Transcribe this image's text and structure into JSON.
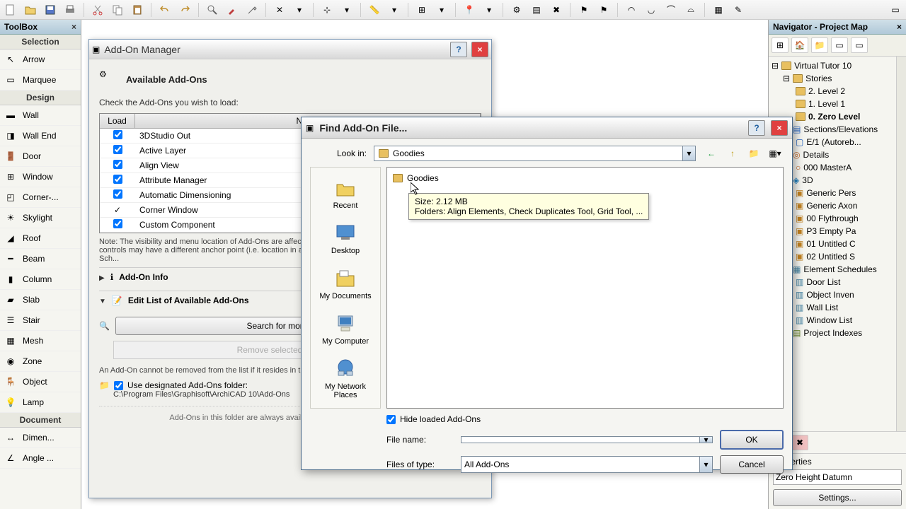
{
  "toolbox": {
    "title": "ToolBox",
    "selectionHead": "Selection",
    "designHead": "Design",
    "documentHead": "Document",
    "items": {
      "arrow": "Arrow",
      "marquee": "Marquee",
      "wall": "Wall",
      "wallEnd": "Wall End",
      "door": "Door",
      "window": "Window",
      "corner": "Corner-...",
      "skylight": "Skylight",
      "roof": "Roof",
      "beam": "Beam",
      "column": "Column",
      "slab": "Slab",
      "stair": "Stair",
      "mesh": "Mesh",
      "zone": "Zone",
      "object": "Object",
      "lamp": "Lamp",
      "dimen": "Dimen...",
      "angle": "Angle ..."
    }
  },
  "navigator": {
    "title": "Navigator - Project Map",
    "root": "Virtual Tutor 10",
    "stories": "Stories",
    "level2": "2. Level 2",
    "level1": "1. Level 1",
    "zero": "0. Zero Level",
    "sections": "Sections/Elevations",
    "e1": "E/1 (Autoreb...",
    "details": "Details",
    "masterA": "000 MasterA",
    "threeD": "3D",
    "genericPers": "Generic Pers",
    "genericAxon": "Generic Axon",
    "flythrough": "00 Flythrough",
    "emptyPa": "P3 Empty Pa",
    "untitledC1": "01 Untitled C",
    "untitledS": "02 Untitled S",
    "elementSched": "Element Schedules",
    "doorList": "Door List",
    "objectInven": "Object Inven",
    "wallList": "Wall List",
    "windowList": "Window List",
    "projectIndexes": "Project Indexes",
    "propsLabel": "Properties",
    "datum": "Zero Height Datumn",
    "settings": "Settings..."
  },
  "addonManager": {
    "title": "Add-On Manager",
    "availableHead": "Available Add-Ons",
    "checkNote": "Check the Add-Ons you wish to load:",
    "colLoad": "Load",
    "colName": "Name",
    "rows": [
      "3DStudio Out",
      "Active Layer",
      "Align View",
      "Attribute Manager",
      "Automatic Dimensioning",
      "Corner Window",
      "Custom Component"
    ],
    "noteTruncated": "Note: The visibility and menu location of Add-Ons are affected by Work Environment settings. The Add-On controls may have a different anchor point (i.e. location in a menu) of Work Environment > Command Layout Sch...",
    "infoHead": "Add-On Info",
    "editHead": "Edit List of Available Add-Ons",
    "searchBtn": "Search for more Add-Ons...",
    "removeBtn": "Remove selected Add-On",
    "removeNote": "An Add-On cannot be removed from the list if it resides in the Add-Ons folder.",
    "designatedCheck": "Use designated Add-Ons folder:",
    "path": "C:\\Program Files\\Graphisoft\\ArchiCAD 10\\Add-Ons",
    "finalNote": "Add-Ons in this folder are always available in the Add-On Manager list"
  },
  "findDialog": {
    "title": "Find Add-On File...",
    "lookInLabel": "Look in:",
    "lookInValue": "Goodies",
    "places": {
      "recent": "Recent",
      "desktop": "Desktop",
      "mydocs": "My Documents",
      "mycomp": "My Computer",
      "network": "My Network Places"
    },
    "fileItem": "Goodies",
    "tooltipSize": "Size: 2.12 MB",
    "tooltipFolders": "Folders: Align Elements, Check Duplicates Tool, Grid Tool, ...",
    "hideLoaded": "Hide loaded Add-Ons",
    "fileNameLabel": "File name:",
    "fileNameValue": "",
    "typeLabel": "Files of type:",
    "typeValue": "All Add-Ons",
    "ok": "OK",
    "cancel": "Cancel"
  }
}
